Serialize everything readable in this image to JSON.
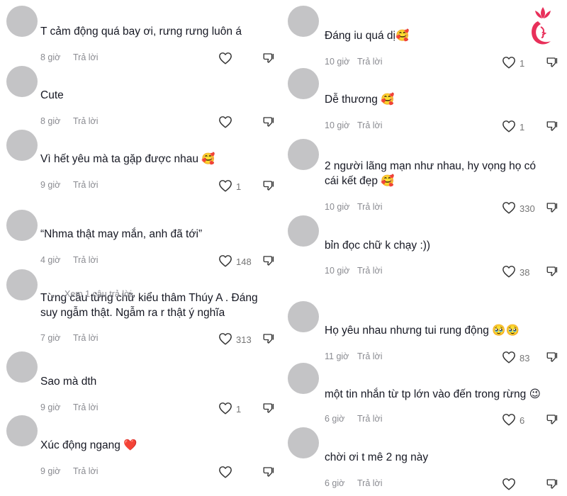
{
  "brand": {
    "accent": "#e8305a",
    "text": "#161823",
    "muted": "#8a8b91",
    "avatar": "#c4c4c6"
  },
  "left": [
    {
      "text": "T cảm động quá bay ơi, rưng rưng luôn á",
      "time": "8 giờ",
      "reply": "Trả lời",
      "likes": "",
      "emoji": ""
    },
    {
      "text": "Cute",
      "time": "8 giờ",
      "reply": "Trả lời",
      "likes": "",
      "emoji": ""
    },
    {
      "text": "Vì hết yêu mà ta gặp được nhau ",
      "time": "9 giờ",
      "reply": "Trả lời",
      "likes": "1",
      "emoji": "🥰"
    },
    {
      "text": "“Nhma thật may mắn, anh đã tới”",
      "time": "4 giờ",
      "reply": "Trả lời",
      "likes": "148",
      "emoji": ""
    },
    {
      "text": "Từng câu từng chữ kiểu thâm Thúy A . Đáng\nsuy ngẫm thật. Ngẫm ra r thật ý nghĩa",
      "time": "7 giờ",
      "reply": "Trả lời",
      "likes": "313",
      "emoji": ""
    },
    {
      "text": "Sao mà dth",
      "time": "9 giờ",
      "reply": "Trả lời",
      "likes": "1",
      "emoji": ""
    },
    {
      "text": "Xúc động ngang ",
      "time": "9 giờ",
      "reply": "Trả lời",
      "likes": "",
      "emoji": "❤️"
    }
  ],
  "right": [
    {
      "text": "Đáng iu quá dị",
      "time": "10 giờ",
      "reply": "Trả lời",
      "likes": "1",
      "emoji": "🥰"
    },
    {
      "text": "Dễ thương ",
      "time": "10 giờ",
      "reply": "Trả lời",
      "likes": "1",
      "emoji": "🥰"
    },
    {
      "text": "2 người lãng mạn như nhau, hy vọng họ có\ncái kết đẹp ",
      "time": "10 giờ",
      "reply": "Trả lời",
      "likes": "330",
      "emoji": "🥰"
    },
    {
      "text": "bỉn đọc chữ k chạy :))",
      "time": "10 giờ",
      "reply": "Trả lời",
      "likes": "38",
      "emoji": ""
    },
    {
      "text": "Họ yêu nhau nhưng tui rung động ",
      "time": "11 giờ",
      "reply": "Trả lời",
      "likes": "83",
      "emoji": "🥹🥹"
    },
    {
      "text": "một tin nhắn từ tp lớn vào đến trong rừng ",
      "time": "6 giờ",
      "reply": "Trả lời",
      "likes": "6",
      "emoji": "😉"
    },
    {
      "text": "chời ơi t mê 2 ng này",
      "time": "6 giờ",
      "reply": "Trả lời",
      "likes": "",
      "emoji": ""
    }
  ],
  "view_replies": "Xem 1 câu trả lời",
  "icons": {
    "like": "heart-outline-icon",
    "dislike": "thumbs-down-outline-icon",
    "logo": "lotus-woman-logo"
  }
}
